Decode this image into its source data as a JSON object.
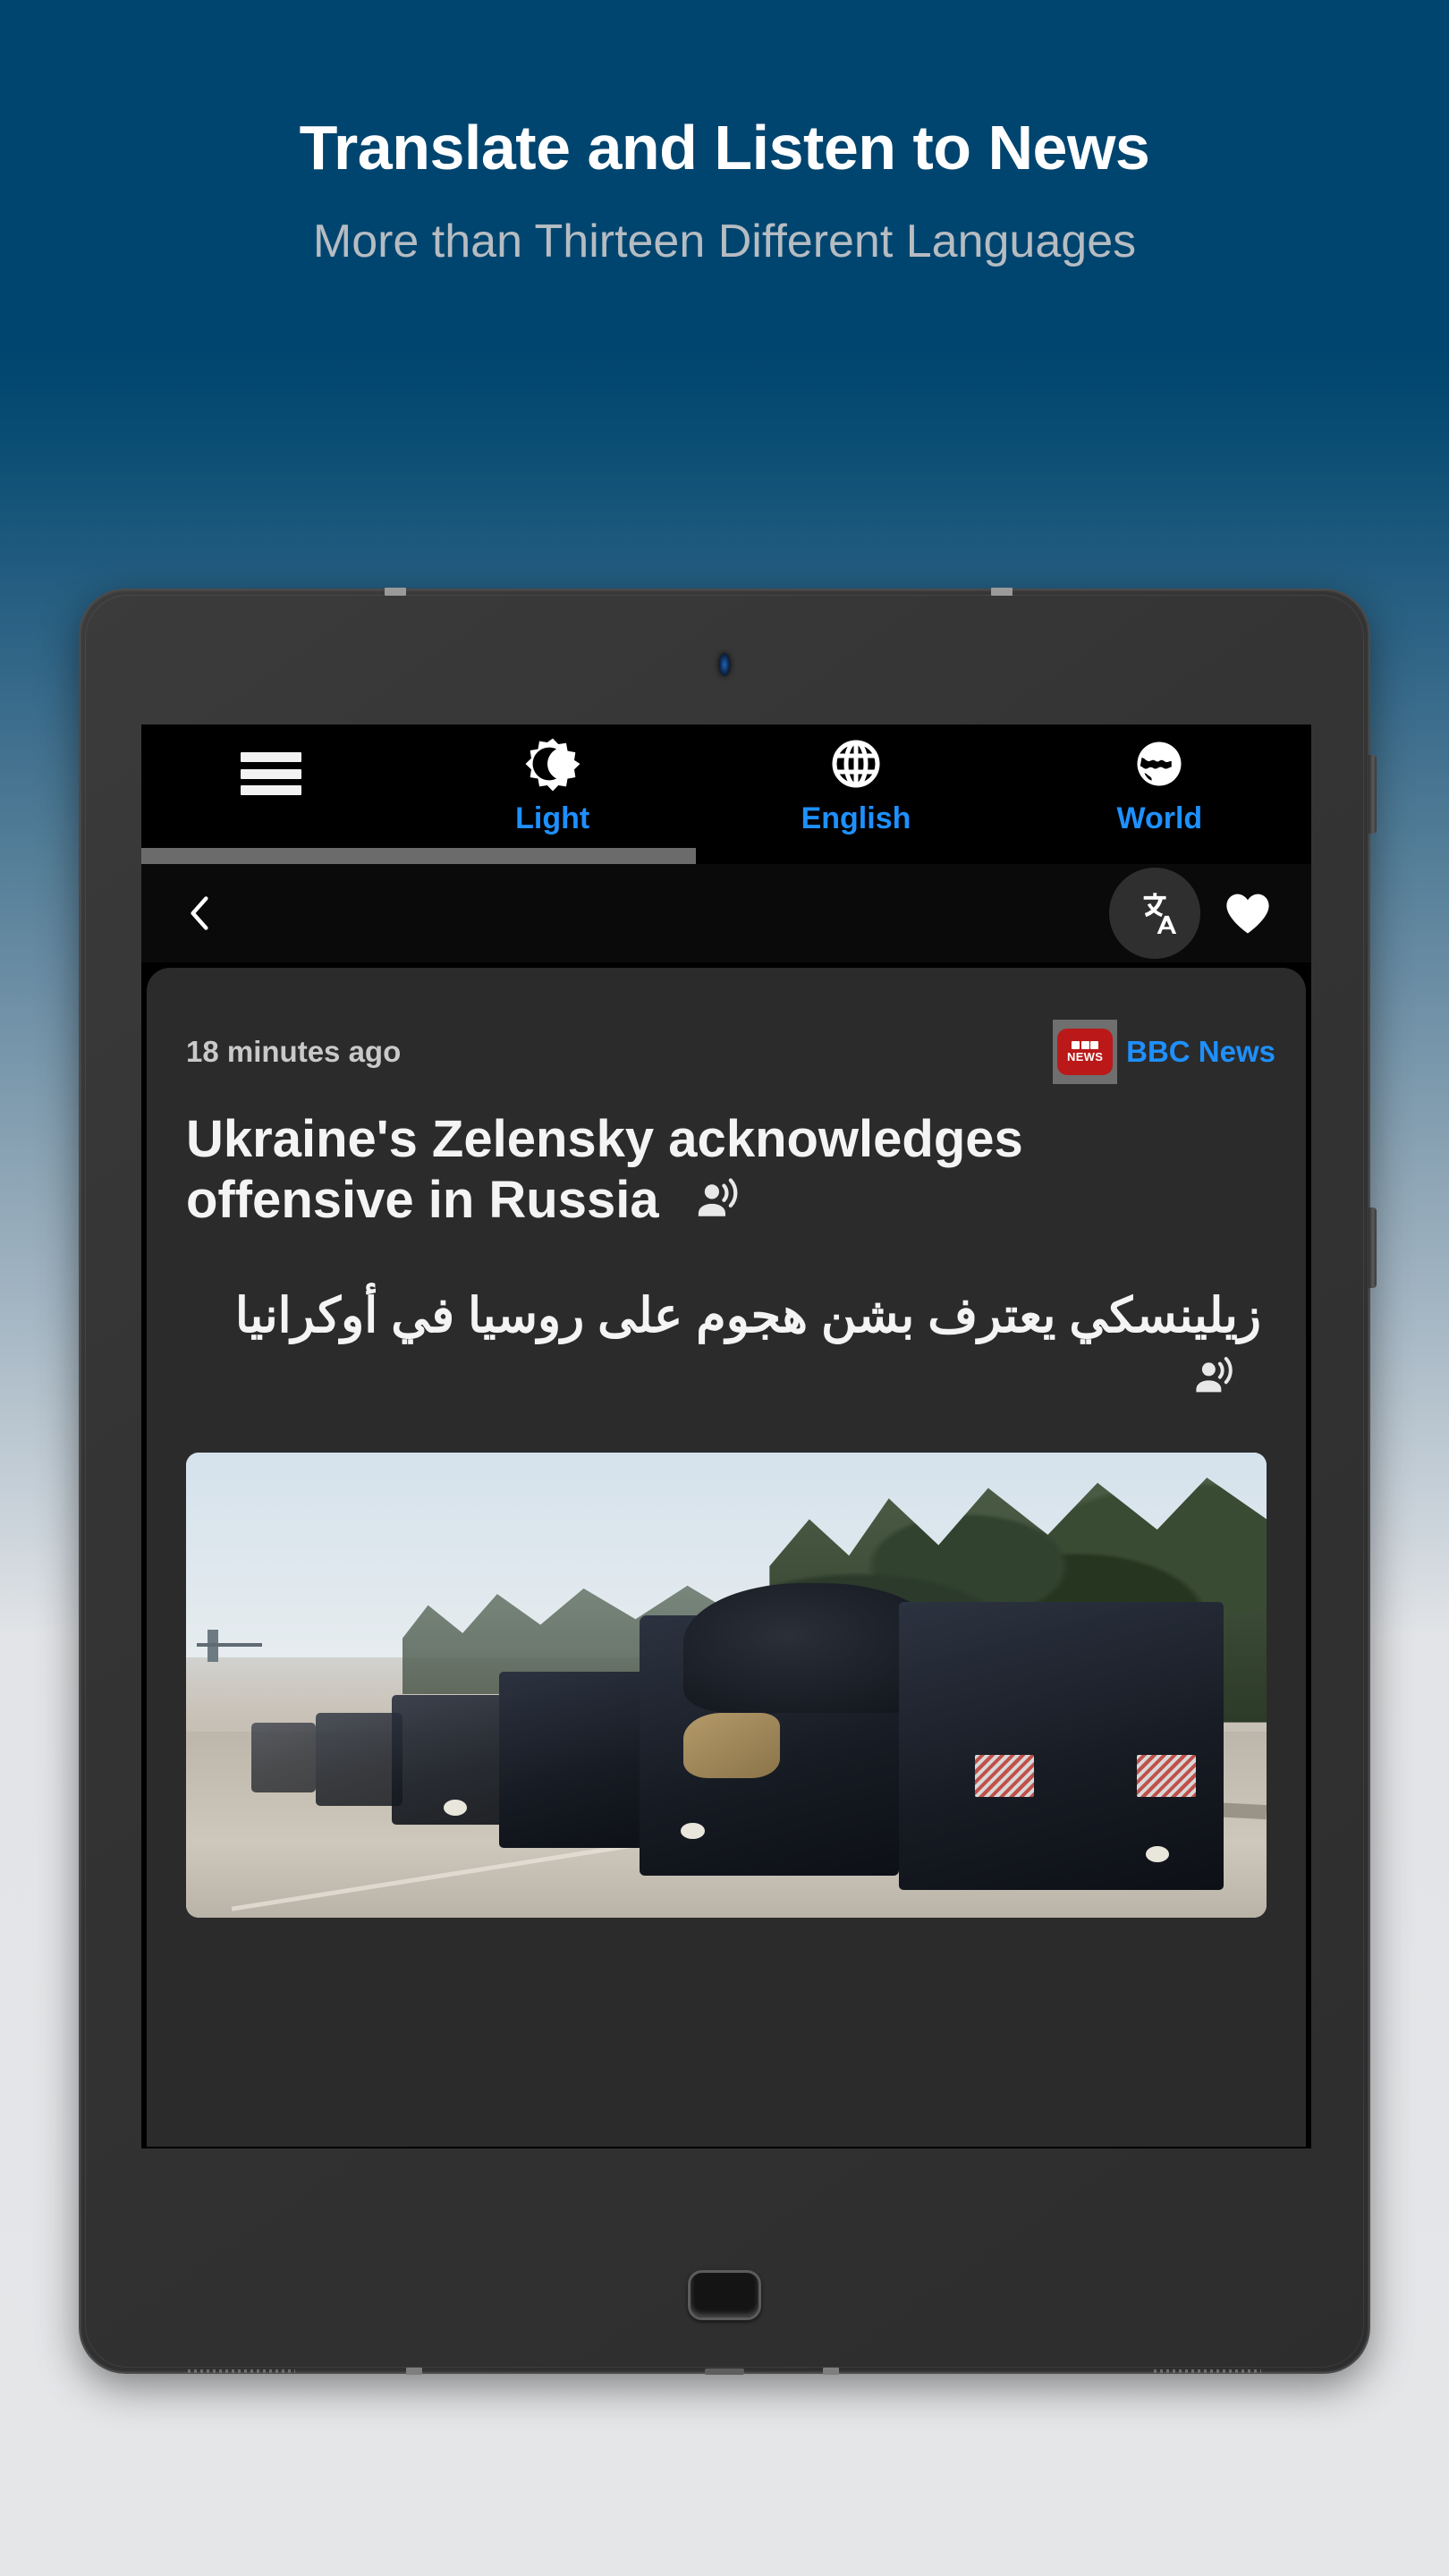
{
  "promo": {
    "title": "Translate and Listen to News",
    "subtitle": "More than Thirteen Different Languages",
    "title_color": "#ffffff",
    "subtitle_color": "#b6bcc2",
    "background_top_color": "#00456f",
    "background_bottom_color": "#e4e6e8"
  },
  "device": {
    "type": "tablet",
    "frame_color": "#343434",
    "home_button": "home-button",
    "camera": "front-camera",
    "side_buttons": [
      "power-button",
      "volume-button"
    ]
  },
  "app": {
    "theme": "dark",
    "accent_color": "#1e90ff",
    "appbar": {
      "menu_icon": "hamburger-menu-icon",
      "tabs": [
        {
          "icon": "brightness-moon-icon",
          "label": "Light"
        },
        {
          "icon": "globe-language-icon",
          "label": "English"
        },
        {
          "icon": "public-world-icon",
          "label": "World"
        }
      ]
    },
    "toolbar": {
      "back_icon": "back-chevron-icon",
      "translate_icon": "translate-icon",
      "favorite_icon": "heart-filled-icon"
    },
    "article": {
      "timestamp": "18 minutes ago",
      "source_name": "BBC News",
      "source_logo_blocks": "BBC",
      "source_logo_word": "NEWS",
      "source_logo_color": "#bb1919",
      "headline": "Ukraine's Zelensky acknowledges offensive in Russia",
      "headline_speak_icon": "record-voice-over-icon",
      "translation": "زيلينسكي يعترف بشن هجوم على روسيا في أوكرانيا",
      "translation_speak_icon": "record-voice-over-icon",
      "image_alt": "military-convoy-photo"
    }
  }
}
